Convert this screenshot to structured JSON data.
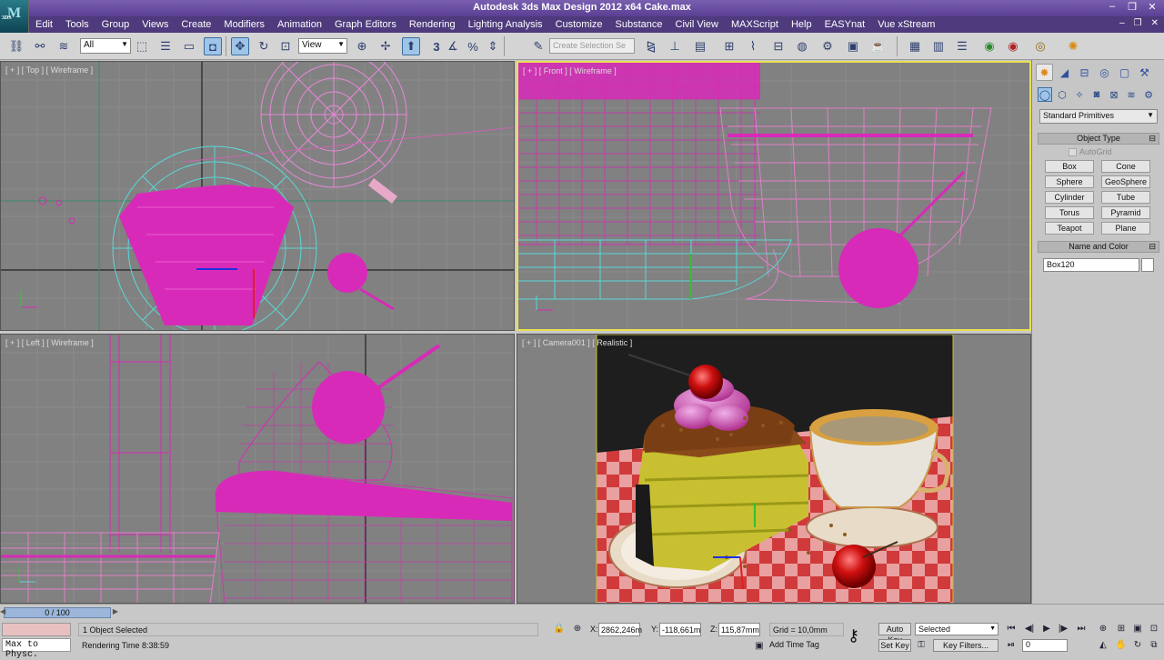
{
  "window": {
    "title": "Autodesk 3ds Max Design 2012 x64     Cake.max",
    "logo_text": "M",
    "logo_sub": "3DS",
    "controls": [
      "–",
      "❐",
      "✕"
    ]
  },
  "menu": {
    "items": [
      "Edit",
      "Tools",
      "Group",
      "Views",
      "Create",
      "Modifiers",
      "Animation",
      "Graph Editors",
      "Rendering",
      "Lighting Analysis",
      "Customize",
      "Substance",
      "Civil View",
      "MAXScript",
      "Help",
      "EASYnat",
      "Vue xStream"
    ],
    "controls": [
      "–",
      "❐",
      "✕"
    ]
  },
  "toolbar": {
    "filter_value": "All",
    "refcoord_value": "View",
    "snap_label": "3",
    "named_selection_placeholder": "Create Selection Se"
  },
  "viewports": {
    "top": "[ + ] [ Top ] [ Wireframe ]",
    "front": "[ + ] [ Front ] [ Wireframe ]",
    "left": "[ + ] [ Left ] [ Wireframe ]",
    "camera": "[ + ] [ Camera001 ] [ Realistic ]"
  },
  "command_panel": {
    "category": "Standard Primitives",
    "object_type_title": "Object Type",
    "autogrid_label": "AutoGrid",
    "buttons": [
      "Box",
      "Cone",
      "Sphere",
      "GeoSphere",
      "Cylinder",
      "Tube",
      "Torus",
      "Pyramid",
      "Teapot",
      "Plane"
    ],
    "name_color_title": "Name and Color",
    "name_value": "Box120",
    "rollout_toggle": "⊟"
  },
  "status": {
    "slider_text": "0 / 100",
    "maxscript_text": "Max to Physc.",
    "selection_text": "1 Object Selected",
    "render_time": "Rendering Time  8:38:59",
    "x_label": "X:",
    "x_value": "2862,246m",
    "y_label": "Y:",
    "y_value": "-118,661m",
    "z_label": "Z:",
    "z_value": "115,87mm",
    "grid": "Grid = 10,0mm",
    "add_time_tag": "Add Time Tag",
    "auto_key": "Auto Key",
    "set_key": "Set Key",
    "key_mode": "Selected",
    "key_filters": "Key Filters...",
    "frame": "0"
  },
  "colors": {
    "wire_magenta": "#d82ab8",
    "wire_cyan": "#5ad8d8",
    "viewport_bg": "#818181",
    "active_border": "#e8e050"
  }
}
